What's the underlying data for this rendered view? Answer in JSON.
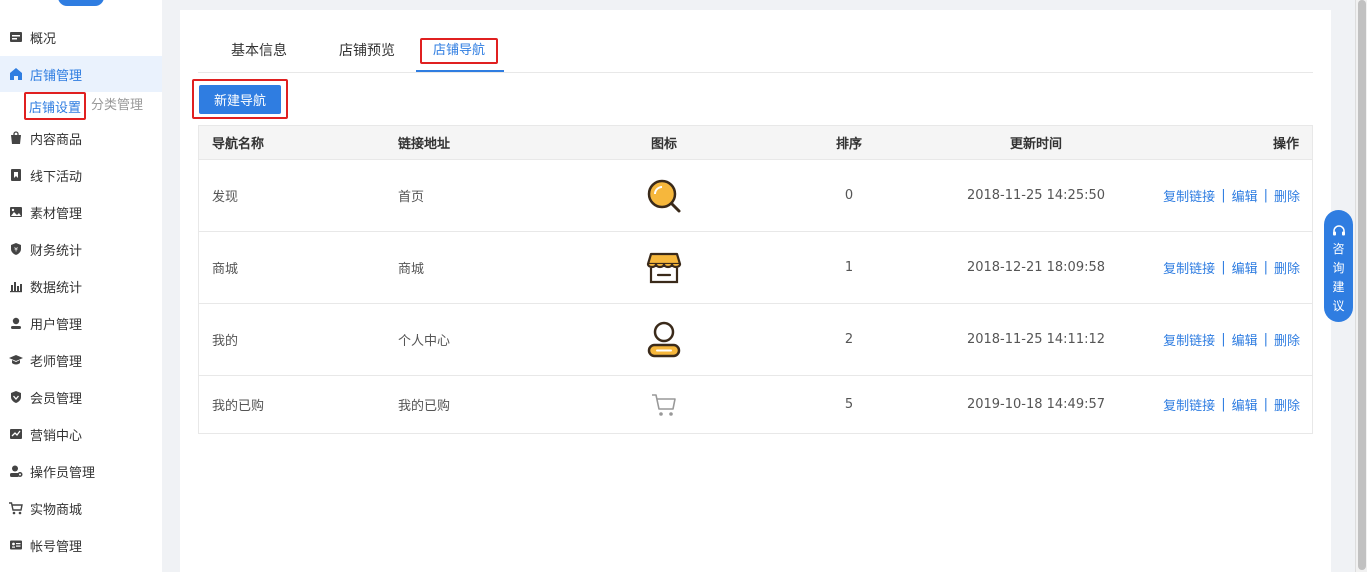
{
  "sidebar": {
    "items": [
      {
        "label": "概况",
        "icon": "overview-icon"
      },
      {
        "label": "店铺管理",
        "icon": "store-icon"
      },
      {
        "label": "内容商品",
        "icon": "content-bag-icon"
      },
      {
        "label": "线下活动",
        "icon": "flag-icon"
      },
      {
        "label": "素材管理",
        "icon": "image-icon"
      },
      {
        "label": "财务统计",
        "icon": "finance-shield-icon"
      },
      {
        "label": "数据统计",
        "icon": "bar-chart-icon"
      },
      {
        "label": "用户管理",
        "icon": "user-icon"
      },
      {
        "label": "老师管理",
        "icon": "graduation-cap-icon"
      },
      {
        "label": "会员管理",
        "icon": "member-badge-icon"
      },
      {
        "label": "营销中心",
        "icon": "trend-chart-icon"
      },
      {
        "label": "操作员管理",
        "icon": "operator-icon"
      },
      {
        "label": "实物商城",
        "icon": "cart-icon"
      },
      {
        "label": "帐号管理",
        "icon": "id-card-icon"
      }
    ],
    "sub_items": [
      {
        "label": "店铺设置"
      },
      {
        "label": "分类管理"
      }
    ]
  },
  "tabs": [
    {
      "label": "基本信息"
    },
    {
      "label": "店铺预览"
    },
    {
      "label": "店铺导航"
    }
  ],
  "actions": {
    "new_nav_label": "新建导航"
  },
  "table": {
    "headers": {
      "name": "导航名称",
      "link": "链接地址",
      "icon": "图标",
      "sort": "排序",
      "time": "更新时间",
      "ops": "操作"
    },
    "rows": [
      {
        "name": "发现",
        "link": "首页",
        "icon": "discover-icon",
        "sort": "0",
        "time": "2018-11-25 14:25:50"
      },
      {
        "name": "商城",
        "link": "商城",
        "icon": "shop-icon",
        "sort": "1",
        "time": "2018-12-21 18:09:58"
      },
      {
        "name": "我的",
        "link": "个人中心",
        "icon": "profile-icon",
        "sort": "2",
        "time": "2018-11-25 14:11:12"
      },
      {
        "name": "我的已购",
        "link": "我的已购",
        "icon": "cart-icon",
        "sort": "5",
        "time": "2019-10-18 14:49:57"
      }
    ],
    "ops": {
      "copy": "复制链接",
      "edit": "编辑",
      "delete": "删除",
      "sep": "|"
    }
  },
  "float_widget": {
    "chars": [
      "咨",
      "询",
      "建",
      "议"
    ],
    "icon": "headset-icon"
  },
  "colors": {
    "primary": "#2f7de1",
    "highlight": "#e02020",
    "icon_orange": "#f6b73c",
    "icon_dark": "#3a2a1a"
  }
}
